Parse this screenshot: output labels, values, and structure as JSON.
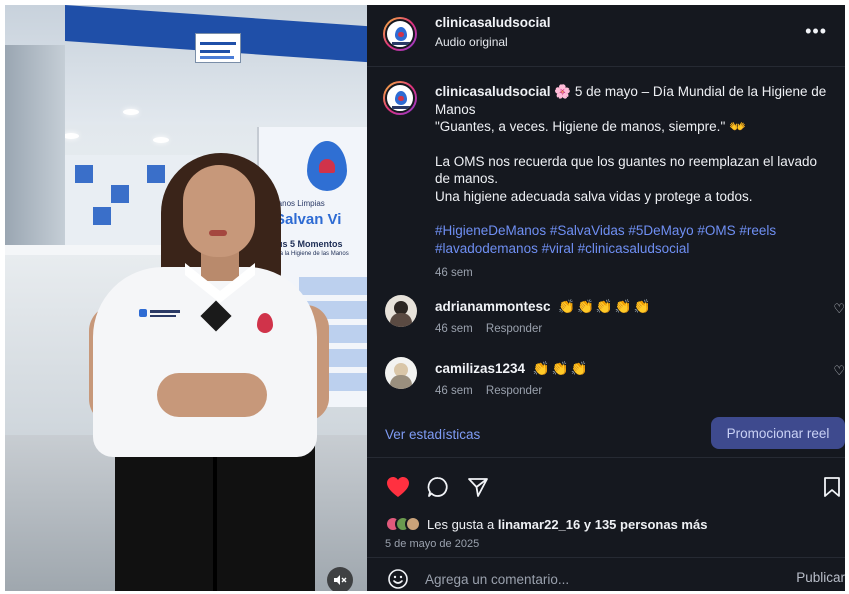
{
  "post": {
    "username": "clinicasaludsocial",
    "audio": "Audio original",
    "more": "•••"
  },
  "caption": {
    "username": "clinicasaludsocial",
    "line1": "🌸 5 de mayo – Día Mundial de la Higiene de Manos",
    "line2": "\"Guantes, a veces. Higiene de manos, siempre.\" 👐",
    "line3": "La OMS nos recuerda que los guantes no reemplazan el lavado de manos.",
    "line4": "Una higiene adecuada salva vidas y protege a todos.",
    "hashtags": "#HigieneDeManos #SalvaVidas #5DeMayo #OMS #reels #lavadodemanos #viral #clinicasaludsocial",
    "age": "46 sem"
  },
  "video_text": {
    "banner_small": "Manos Limpias",
    "banner_big": "Salvan Vi",
    "banner_sub": "Sus 5 Momentos",
    "banner_sub2": "para la Higiene de las Manos"
  },
  "comments": [
    {
      "username": "adrianammontesc",
      "emojis": "👏👏👏👏👏",
      "age": "46 sem",
      "reply": "Responder"
    },
    {
      "username": "camilizas1234",
      "emojis": "👏👏👏",
      "age": "46 sem",
      "reply": "Responder"
    }
  ],
  "stats_link": "Ver estadísticas",
  "promote_button": "Promocionar reel",
  "likes": {
    "prefix": "Les gusta a",
    "user": "linamar22_16",
    "suffix": "y 135 personas más"
  },
  "date": "5 de mayo de 2025",
  "composer": {
    "placeholder": "Agrega un comentario...",
    "publish": "Publicar"
  },
  "colors": {
    "panel_bg": "#15181f",
    "hashtag": "#6f8ff3",
    "like_heart": "#ff3040",
    "promote_bg": "#3e4a8e"
  }
}
